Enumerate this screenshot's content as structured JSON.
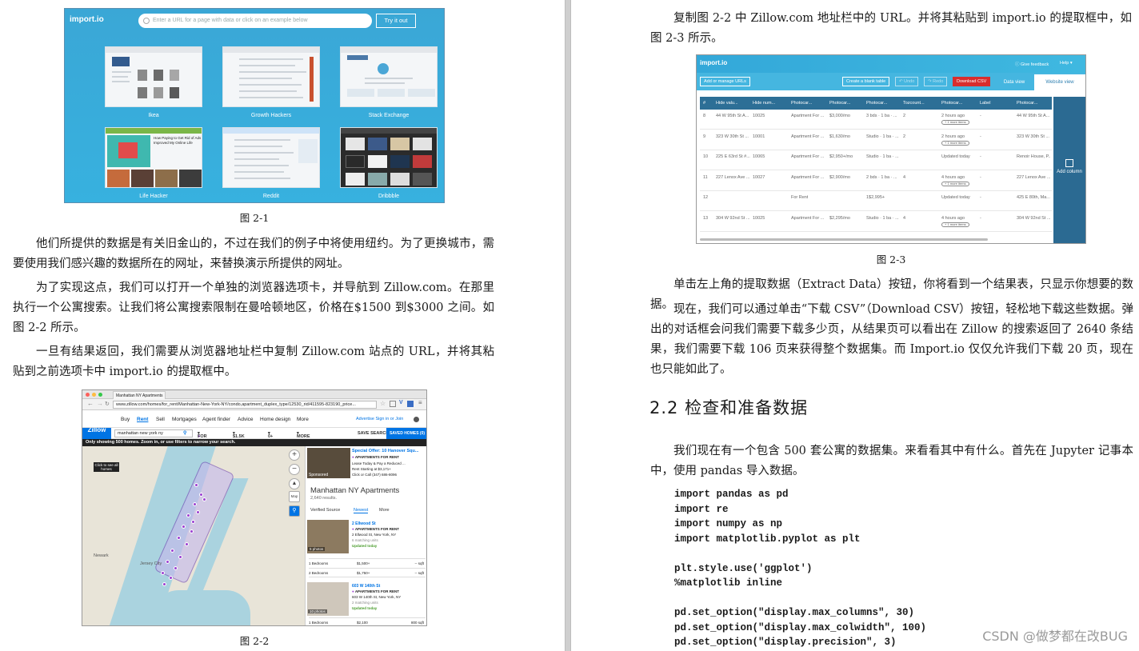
{
  "left_page": {
    "figure_2_1": {
      "logo": "import.io",
      "url_placeholder": "Enter a URL for a page with data or click on an example below",
      "try_button": "Try it out",
      "examples": [
        {
          "label": "Ikea"
        },
        {
          "label": "Growth Hackers"
        },
        {
          "label": "Stack Exchange"
        },
        {
          "label": "Life Hacker"
        },
        {
          "label": "Reddit"
        },
        {
          "label": "Dribbble"
        }
      ],
      "lifehacker_headline": "How Paying to Get Rid of Ads Improved My Online Life",
      "caption": "图 2-1"
    },
    "paragraphs": [
      "他们所提供的数据是有关旧金山的，不过在我们的例子中将使用纽约。为了更换城市，需要使用我们感兴趣的数据所在的网址，来替换演示所提供的网址。",
      "为了实现这点，我们可以打开一个单独的浏览器选项卡，并导航到 Zillow.com。在那里执行一个公寓搜索。让我们将公寓搜索限制在曼哈顿地区，价格在$1500 到$3000 之间。如图 2-2 所示。",
      "一旦有结果返回，我们需要从浏览器地址栏中复制 Zillow.com 站点的 URL，并将其粘贴到之前选项卡中 import.io 的提取框中。"
    ],
    "figure_2_2": {
      "tab_title": "Manhattan NY Apartments",
      "address": "www.zillow.com/homes/for_rent/Manhattan-New-York-NY/condo,apartment_duplex_type/12530_rid/411595-823190_price...",
      "logo": "Zillow",
      "nav": [
        "Buy",
        "Rent",
        "Sell",
        "Mortgages",
        "Agent finder",
        "Advice",
        "Home design",
        "More"
      ],
      "nav_right": "Advertise  Sign in or Join",
      "search_value": "manhattan new york ny",
      "filters": [
        "FOR RENT",
        "$1.5K - $3K",
        "0+ BEDS",
        "MORE (1)"
      ],
      "save_search": "SAVE SEARCH",
      "saved_homes": "SAVED HOMES (0)",
      "banner": "Only showing 500 homes. Zoom in, or use filters to narrow your search.",
      "map_hint": "Click to see all homes",
      "map_label_jersey": "Jersey City",
      "map_label_newark": "Newark",
      "promo": {
        "title": "Special Offer: 10 Hanover Squ...",
        "type": "APARTMENTS FOR RENT",
        "line1": "Lease Today & Pay a Reduced ...",
        "line2": "Rent Starting at $3,171+",
        "line3": "Click or Call (347) 686-8096",
        "sponsored": "Sponsored"
      },
      "results_title": "Manhattan NY Apartments",
      "results_count": "2,640 results.",
      "tabs": [
        "Verified Source",
        "Newest",
        "More"
      ],
      "listings": [
        {
          "name": "2 Ellwood St",
          "type": "APARTMENTS FOR RENT",
          "addr": "2 Ellwood St, New York, NY",
          "units": "6 matching units",
          "updated": "Updated today",
          "photos": "5 photos",
          "rows": [
            {
              "beds": "1 Bedrooms",
              "price": "$1,500+",
              "sqft": "-- sqft"
            },
            {
              "beds": "2 Bedrooms",
              "price": "$1,750+",
              "sqft": "-- sqft"
            }
          ]
        },
        {
          "name": "603 W 140th St",
          "type": "APARTMENTS FOR RENT",
          "addr": "603 W 140th St, New York, NY",
          "units": "2 matching units",
          "updated": "Updated today",
          "photos": "10 photos",
          "rows": [
            {
              "beds": "1 Bedrooms",
              "price": "$2,100",
              "sqft": "800 sqft"
            }
          ]
        }
      ],
      "caption": "图 2-2"
    }
  },
  "right_page": {
    "intro": "复制图 2-2 中 Zillow.com 地址栏中的 URL。并将其粘贴到 import.io 的提取框中，如图 2-3 所示。",
    "figure_2_3": {
      "logo": "import.io",
      "give_feedback": "Give feedback",
      "help": "Help",
      "add_urls": "Add or manage URLs",
      "create_table": "Create a blank table",
      "undo": "Undo",
      "redo": "Redo",
      "download_csv": "Download CSV",
      "tab_data": "Data view",
      "tab_website": "Website view",
      "columns": [
        "#",
        "Hide valu...",
        "Hide num...",
        "Photocar...",
        "Photocar...",
        "Photocar...",
        "Tozcount...",
        "Photocar...",
        "Label",
        "Photocar..."
      ],
      "rows": [
        [
          "8",
          "44 W 95th St A...",
          "10025",
          "Apartment For ...",
          "$3,000/mo",
          "3 bds · 1 ba · ...",
          "2",
          "2 hours ago",
          "-",
          "44 W 95th St A..."
        ],
        [
          "9",
          "323 W 30th St ...",
          "10001",
          "Apartment For ...",
          "$1,630/mo",
          "Studio · 1 ba · ...",
          "2",
          "2 hours ago",
          "-",
          "323 W 30th St ..."
        ],
        [
          "10",
          "225 E 63rd St #...",
          "10065",
          "Apartment For ...",
          "$2,950+/mo",
          "Studio · 1 ba · ...",
          "",
          "Updated today",
          "-",
          "Renoir House, P..."
        ],
        [
          "11",
          "227 Lenox Ave ...",
          "10027",
          "Apartment For ...",
          "$2,900/mo",
          "2 bds · 1 ba · ...",
          "4",
          "4 hours ago",
          "-",
          "227 Lenox Ave ..."
        ],
        [
          "12",
          "",
          "",
          "For Rent",
          "",
          "1$2,995+",
          "",
          "Updated today",
          "-",
          "425 E 80th, Ma..."
        ],
        [
          "13",
          "304 W 92nd St ...",
          "10025",
          "Apartment For ...",
          "$2,295/mo",
          "Studio · 1 ba · ...",
          "4",
          "4 hours ago",
          "-",
          "304 W 92nd St ..."
        ]
      ],
      "more_tag": "+ 1 more items",
      "add_column": "Add column",
      "caption": "图 2-3"
    },
    "paragraphs": [
      "单击左上角的提取数据（Extract Data）按钮，你将看到一个结果表，只显示你想要的数据。",
      "现在，我们可以通过单击“下载 CSV”（Download CSV）按钮，轻松地下载这些数据。弹出的对话框会问我们需要下载多少页，从结果页可以看出在 Zillow 的搜索返回了 2640 条结果，我们需要下载 106 页来获得整个数据集。而 Import.io 仅仅允许我们下载 20 页，现在也只能如此了。"
    ],
    "section_title": "2.2  检查和准备数据",
    "section_intro": "我们现在有一个包含 500 套公寓的数据集。来看看其中有什么。首先在 Jupyter 记事本中，使用 pandas 导入数据。",
    "code": "import pandas as pd\nimport re\nimport numpy as np\nimport matplotlib.pyplot as plt\n\nplt.style.use('ggplot')\n%matplotlib inline\n\npd.set_option(\"display.max_columns\", 30)\npd.set_option(\"display.max_colwidth\", 100)\npd.set_option(\"display.precision\", 3)"
  },
  "watermark": "CSDN @做梦都在改BUG"
}
